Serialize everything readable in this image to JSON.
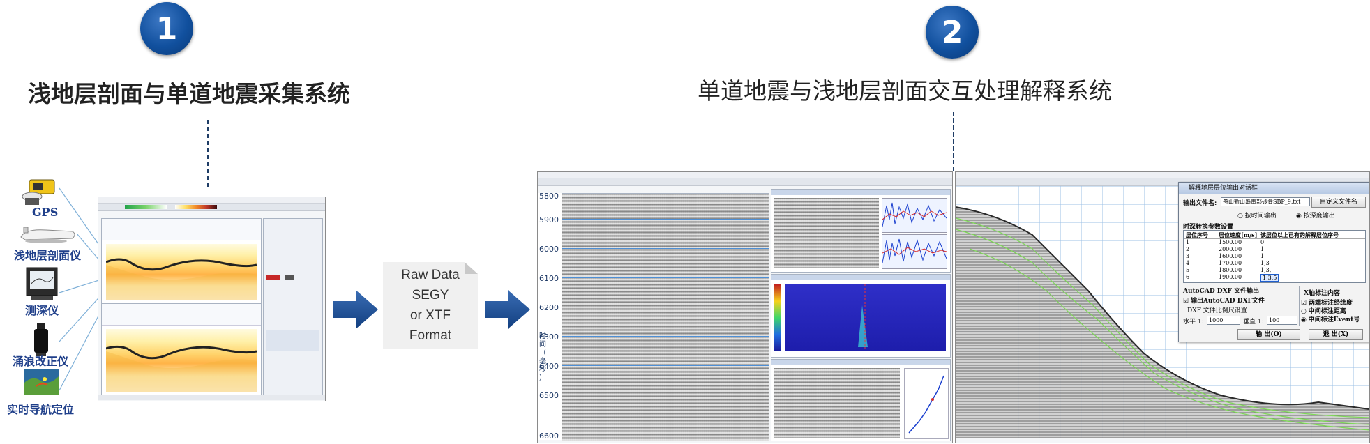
{
  "colors": {
    "badge": "#11509e",
    "arrow": "#1d4f93",
    "device_label": "#1f3f8a",
    "connector": "#7fb0d8"
  },
  "step1": {
    "badge": "1",
    "title": "浅地层剖面与单道地震采集系统"
  },
  "step2": {
    "badge": "2",
    "title": "单道地震与浅地层剖面交互处理解释系统"
  },
  "devices": [
    {
      "label": "GPS",
      "icon": "gps-receiver-icon"
    },
    {
      "label": "浅地层剖面仪",
      "icon": "towfish-sub-bottom-profiler-icon"
    },
    {
      "label": "测深仪",
      "icon": "echo-sounder-icon"
    },
    {
      "label": "涌浪改正仪",
      "icon": "heave-compensator-icon"
    },
    {
      "label": "实时导航定位",
      "icon": "navigation-map-icon"
    }
  ],
  "data_format": {
    "lines": [
      "Raw Data",
      "SEGY",
      "or XTF",
      "Format"
    ]
  },
  "seismic_axis": {
    "ticks": [
      "5800",
      "5900",
      "6000",
      "6100",
      "6200",
      "6300",
      "6400",
      "6500",
      "6600"
    ],
    "label_chars": [
      "时",
      "间",
      "（",
      "毫",
      "秒",
      "）"
    ]
  },
  "dialog": {
    "title": "解释地层层位输出对话框",
    "output_file_label": "输出文件名:",
    "output_file_value": "舟山衢山岛南部砂脊SBP_9.txt",
    "custom_name_button": "自定义文件名",
    "radio_by_time": "按时间输出",
    "radio_by_depth": "按深度输出",
    "section_time_depth": "时深转换参数设置",
    "table_headers": [
      "层位序号",
      "层位速度[m/s]",
      "该层位以上已有的解释层位序号"
    ],
    "table_rows": [
      [
        "1",
        "1500.00",
        "0"
      ],
      [
        "2",
        "2000.00",
        "1"
      ],
      [
        "3",
        "1600.00",
        "1"
      ],
      [
        "4",
        "1700.00",
        "1,3"
      ],
      [
        "5",
        "1800.00",
        "1,3,"
      ],
      [
        "6",
        "1900.00",
        "1,3,5"
      ]
    ],
    "section_dxf": "AutoCAD DXF 文件输出",
    "checkbox_output_dxf": "输出AutoCAD DXF文件",
    "label_scale": "DXF 文件比例尺设置",
    "horizontal_label": "水平 1:",
    "horizontal_value": "1000",
    "vertical_label": "垂直 1:",
    "vertical_value": "100",
    "axis_content_label": "X轴标注内容",
    "opt_lat_lon": "两端标注经纬度",
    "opt_distance": "中间标注距离",
    "opt_event": "中间标注Event号",
    "output_button": "输 出(O)",
    "exit_button": "退 出(X)"
  }
}
